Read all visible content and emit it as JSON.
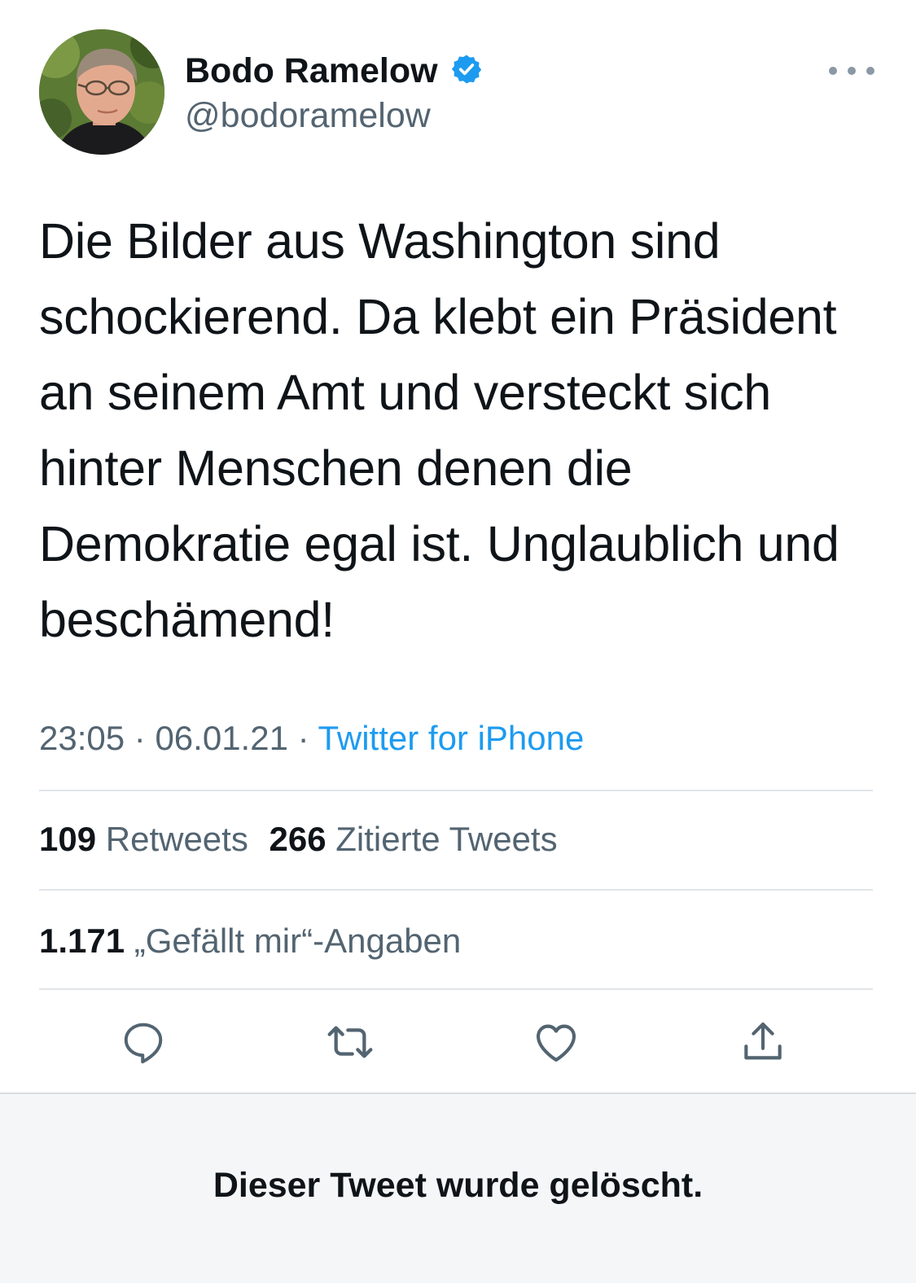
{
  "user": {
    "display_name": "Bodo Ramelow",
    "handle": "@bodoramelow",
    "verified": true,
    "verified_icon": "verified-badge-icon",
    "avatar": "profile-photo"
  },
  "tweet": {
    "text": "Die Bilder aus Washington sind schockierend. Da klebt ein Präsident an seinem Amt und versteckt sich hinter Menschen denen die Demokratie egal ist. Unglaublich und beschämend!",
    "time": "23:05",
    "separator": "·",
    "date": "06.01.21",
    "source": "Twitter for iPhone"
  },
  "stats": {
    "retweets_count": "109",
    "retweets_label": "Retweets",
    "quotes_count": "266",
    "quotes_label": "Zitierte Tweets",
    "likes_count": "1.171",
    "likes_label": "„Gefällt mir“-Angaben"
  },
  "actions": [
    {
      "icon": "reply-icon"
    },
    {
      "icon": "retweet-icon"
    },
    {
      "icon": "like-icon"
    },
    {
      "icon": "share-icon"
    }
  ],
  "notice": {
    "deleted_text": "Dieser Tweet wurde gelöscht."
  },
  "colors": {
    "text_primary": "#0f1419",
    "text_secondary": "#536471",
    "link": "#1d9bf0",
    "verified": "#1d9bf0",
    "divider": "#e1e5e9",
    "notice_background": "#f5f6f8"
  }
}
